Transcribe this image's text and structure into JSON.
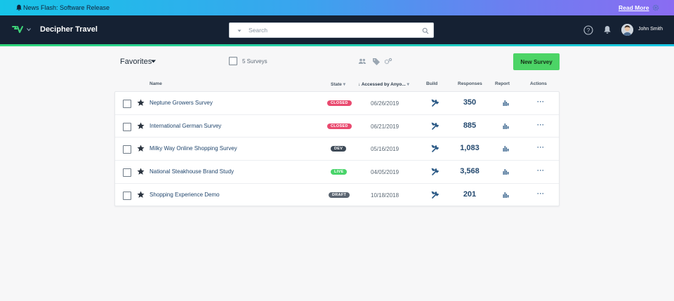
{
  "newsbar": {
    "text": "News Flash: Software Release",
    "read_more": "Read More",
    "icons": [
      "bell-icon",
      "gear-icon"
    ]
  },
  "header": {
    "brand": "Decipher Travel",
    "search_placeholder": "Search",
    "user": "John Smith",
    "icons": [
      "logo-icon",
      "help-icon",
      "bell-icon",
      "avatar",
      "search-icon"
    ]
  },
  "toolbar": {
    "favorites": "Favorites",
    "survey_count": "5 Surveys",
    "new_survey": "New Survey",
    "icons": [
      "users-icon",
      "tag-icon",
      "settings-icon"
    ]
  },
  "columns": {
    "name": "Name",
    "state": "State",
    "accessed": "Accessed by Anyo...",
    "build": "Build",
    "responses": "Responses",
    "report": "Report",
    "actions": "Actions"
  },
  "colors": {
    "closed": "#e94a6f",
    "dev": "#3e4a57",
    "live": "#49d46a",
    "draft": "#5a6470",
    "accent": "#4cd466",
    "header_bg": "#152133"
  },
  "rows": [
    {
      "name": "Neptune Growers Survey",
      "state": "CLOSED",
      "state_color": "#e94a6f",
      "date": "06/26/2019",
      "responses": "350",
      "actions": "···"
    },
    {
      "name": "International German Survey",
      "state": "CLOSED",
      "state_color": "#e94a6f",
      "date": "06/21/2019",
      "responses": "885",
      "actions": "···"
    },
    {
      "name": "Milky Way Online Shopping Survey",
      "state": "DEV",
      "state_color": "#3e4a57",
      "date": "05/16/2019",
      "responses": "1,083",
      "actions": "···"
    },
    {
      "name": "National Steakhouse Brand Study",
      "state": "LIVE",
      "state_color": "#49d46a",
      "date": "04/05/2019",
      "responses": "3,568",
      "actions": "···"
    },
    {
      "name": "Shopping Experience Demo",
      "state": "DRAFT",
      "state_color": "#5a6470",
      "date": "10/18/2018",
      "responses": "201",
      "actions": "···"
    }
  ]
}
